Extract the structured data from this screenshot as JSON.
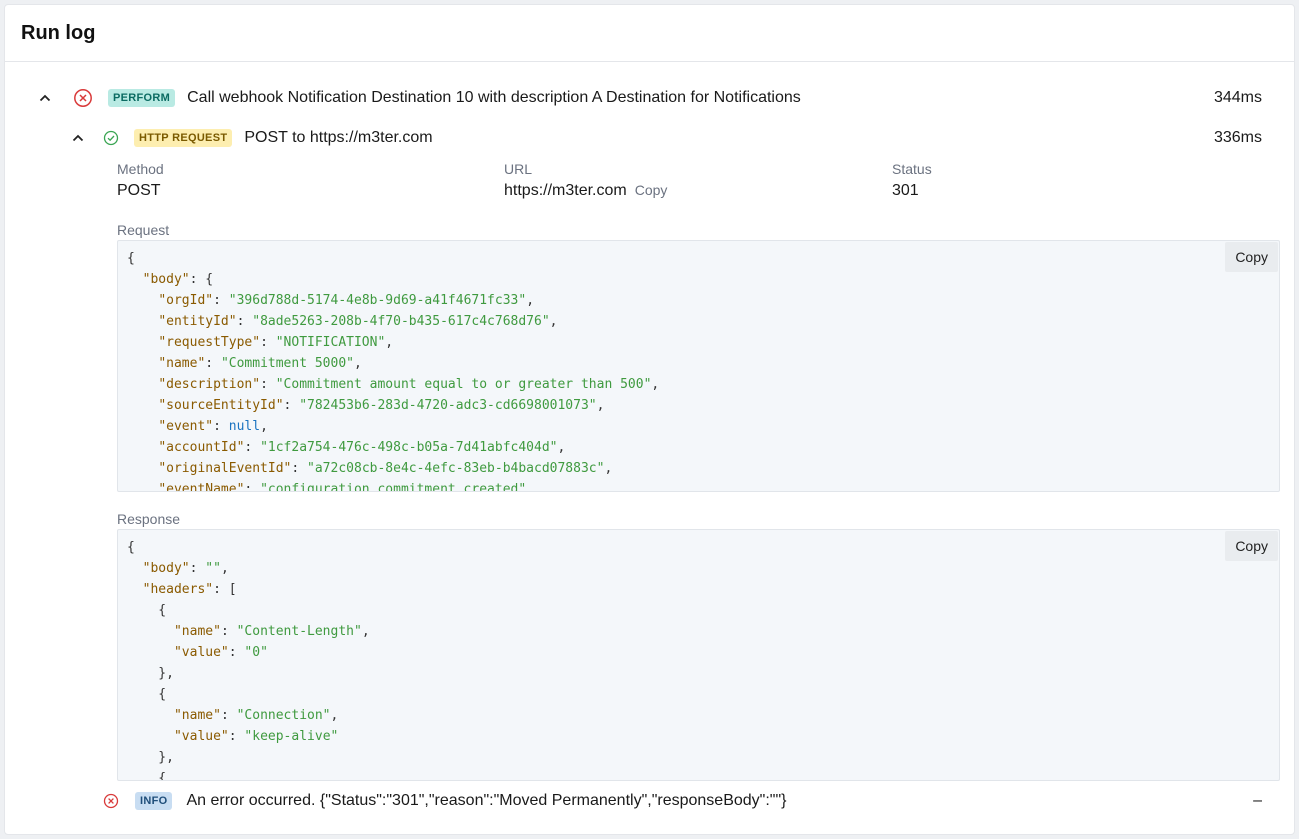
{
  "title": "Run log",
  "perform": {
    "badge": "PERFORM",
    "title": "Call webhook Notification Destination 10 with description A Destination for Notifications",
    "duration": "344ms"
  },
  "http": {
    "badge": "HTTP REQUEST",
    "title": "POST to https://m3ter.com",
    "duration": "336ms",
    "method_label": "Method",
    "method_value": "POST",
    "url_label": "URL",
    "url_value": "https://m3ter.com",
    "url_copy": "Copy",
    "status_label": "Status",
    "status_value": "301"
  },
  "request": {
    "label": "Request",
    "copy": "Copy",
    "lines": [
      [
        [
          "p",
          "{"
        ]
      ],
      [
        [
          "p",
          "  "
        ],
        [
          "k",
          "\"body\""
        ],
        [
          "p",
          ": {"
        ]
      ],
      [
        [
          "p",
          "    "
        ],
        [
          "k",
          "\"orgId\""
        ],
        [
          "p",
          ": "
        ],
        [
          "s",
          "\"396d788d-5174-4e8b-9d69-a41f4671fc33\""
        ],
        [
          "p",
          ","
        ]
      ],
      [
        [
          "p",
          "    "
        ],
        [
          "k",
          "\"entityId\""
        ],
        [
          "p",
          ": "
        ],
        [
          "s",
          "\"8ade5263-208b-4f70-b435-617c4c768d76\""
        ],
        [
          "p",
          ","
        ]
      ],
      [
        [
          "p",
          "    "
        ],
        [
          "k",
          "\"requestType\""
        ],
        [
          "p",
          ": "
        ],
        [
          "s",
          "\"NOTIFICATION\""
        ],
        [
          "p",
          ","
        ]
      ],
      [
        [
          "p",
          "    "
        ],
        [
          "k",
          "\"name\""
        ],
        [
          "p",
          ": "
        ],
        [
          "s",
          "\"Commitment 5000\""
        ],
        [
          "p",
          ","
        ]
      ],
      [
        [
          "p",
          "    "
        ],
        [
          "k",
          "\"description\""
        ],
        [
          "p",
          ": "
        ],
        [
          "s",
          "\"Commitment amount equal to or greater than 500\""
        ],
        [
          "p",
          ","
        ]
      ],
      [
        [
          "p",
          "    "
        ],
        [
          "k",
          "\"sourceEntityId\""
        ],
        [
          "p",
          ": "
        ],
        [
          "s",
          "\"782453b6-283d-4720-adc3-cd6698001073\""
        ],
        [
          "p",
          ","
        ]
      ],
      [
        [
          "p",
          "    "
        ],
        [
          "k",
          "\"event\""
        ],
        [
          "p",
          ": "
        ],
        [
          "n",
          "null"
        ],
        [
          "p",
          ","
        ]
      ],
      [
        [
          "p",
          "    "
        ],
        [
          "k",
          "\"accountId\""
        ],
        [
          "p",
          ": "
        ],
        [
          "s",
          "\"1cf2a754-476c-498c-b05a-7d41abfc404d\""
        ],
        [
          "p",
          ","
        ]
      ],
      [
        [
          "p",
          "    "
        ],
        [
          "k",
          "\"originalEventId\""
        ],
        [
          "p",
          ": "
        ],
        [
          "s",
          "\"a72c08cb-8e4c-4efc-83eb-b4bacd07883c\""
        ],
        [
          "p",
          ","
        ]
      ],
      [
        [
          "p",
          "    "
        ],
        [
          "k",
          "\"eventName\""
        ],
        [
          "p",
          ": "
        ],
        [
          "s",
          "\"configuration.commitment.created\""
        ],
        [
          "p",
          ","
        ]
      ]
    ]
  },
  "response": {
    "label": "Response",
    "copy": "Copy",
    "lines": [
      [
        [
          "p",
          "{"
        ]
      ],
      [
        [
          "p",
          "  "
        ],
        [
          "k",
          "\"body\""
        ],
        [
          "p",
          ": "
        ],
        [
          "s",
          "\"\""
        ],
        [
          "p",
          ","
        ]
      ],
      [
        [
          "p",
          "  "
        ],
        [
          "k",
          "\"headers\""
        ],
        [
          "p",
          ": ["
        ]
      ],
      [
        [
          "p",
          "    {"
        ]
      ],
      [
        [
          "p",
          "      "
        ],
        [
          "k",
          "\"name\""
        ],
        [
          "p",
          ": "
        ],
        [
          "s",
          "\"Content-Length\""
        ],
        [
          "p",
          ","
        ]
      ],
      [
        [
          "p",
          "      "
        ],
        [
          "k",
          "\"value\""
        ],
        [
          "p",
          ": "
        ],
        [
          "s",
          "\"0\""
        ]
      ],
      [
        [
          "p",
          "    },"
        ]
      ],
      [
        [
          "p",
          "    {"
        ]
      ],
      [
        [
          "p",
          "      "
        ],
        [
          "k",
          "\"name\""
        ],
        [
          "p",
          ": "
        ],
        [
          "s",
          "\"Connection\""
        ],
        [
          "p",
          ","
        ]
      ],
      [
        [
          "p",
          "      "
        ],
        [
          "k",
          "\"value\""
        ],
        [
          "p",
          ": "
        ],
        [
          "s",
          "\"keep-alive\""
        ]
      ],
      [
        [
          "p",
          "    },"
        ]
      ],
      [
        [
          "p",
          "    {"
        ]
      ]
    ]
  },
  "info": {
    "badge": "INFO",
    "title": "An error occurred. {\"Status\":\"301\",\"reason\":\"Moved Permanently\",\"responseBody\":\"\"}",
    "duration": "–"
  },
  "colors": {
    "error": "#d93a3a",
    "success": "#3aa553",
    "key": "#8a5a00",
    "string": "#3f9a3f",
    "null": "#1a73c0"
  }
}
